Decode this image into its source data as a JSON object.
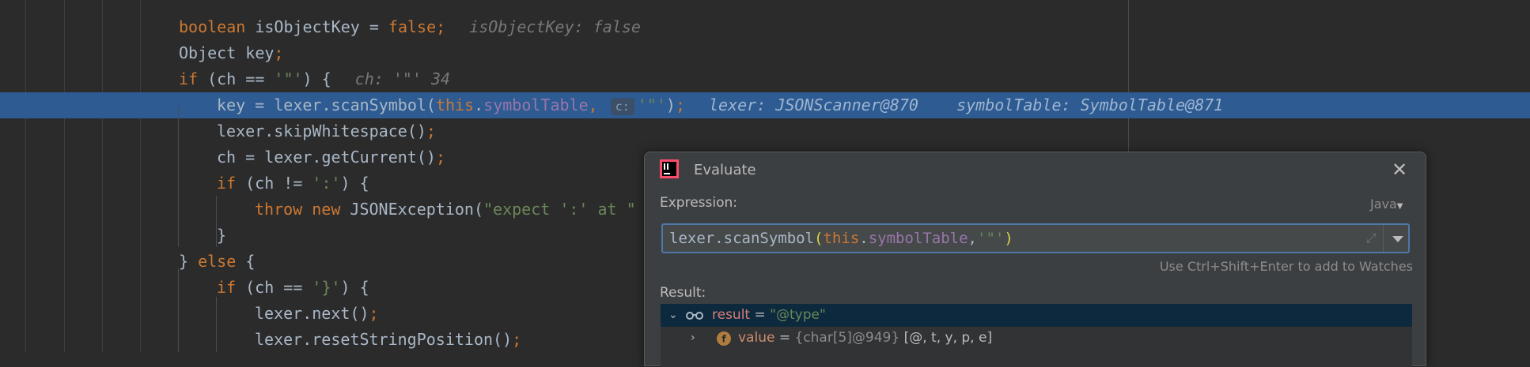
{
  "code_lines": [
    {
      "t": [
        [
          "kw",
          "boolean "
        ],
        [
          "",
          "isObjectKey = "
        ],
        [
          "kw",
          "false"
        ],
        [
          "kw",
          ";"
        ]
      ],
      "hint": "isObjectKey: false"
    },
    {
      "t": [
        [
          "",
          "Object key"
        ],
        [
          "kw",
          ";"
        ]
      ]
    },
    {
      "t": [
        [
          "kw",
          "if "
        ],
        [
          "",
          "(ch == "
        ],
        [
          "str",
          "'\"'"
        ],
        [
          "",
          ") {"
        ]
      ],
      "hint": "ch: '\"' 34"
    },
    {
      "t": [
        [
          "",
          "key = lexer.scanSymbol("
        ],
        [
          "kw",
          "this"
        ],
        [
          "",
          "."
        ],
        [
          "fld",
          "symbolTable"
        ],
        [
          "kw",
          ", "
        ]
      ],
      "param": "c:",
      "t2": [
        [
          "str",
          "'\"'"
        ],
        [
          "",
          ")"
        ],
        [
          "kw",
          ";"
        ]
      ],
      "hint": "lexer: JSONScanner@870    symbolTable: SymbolTable@871"
    },
    {
      "t": [
        [
          "",
          "lexer.skipWhitespace()"
        ],
        [
          "kw",
          ";"
        ]
      ]
    },
    {
      "t": [
        [
          "",
          "ch = lexer.getCurrent()"
        ],
        [
          "kw",
          ";"
        ]
      ]
    },
    {
      "t": [
        [
          "kw",
          "if "
        ],
        [
          "",
          "(ch != "
        ],
        [
          "str",
          "':'"
        ],
        [
          "",
          ") {"
        ]
      ]
    },
    {
      "t": [
        [
          "kw",
          "throw new "
        ],
        [
          "",
          "JSONException("
        ],
        [
          "str",
          "\"expect ':' at \" "
        ]
      ]
    },
    {
      "t": [
        [
          "",
          "}"
        ]
      ]
    },
    {
      "t": [
        [
          "",
          "} "
        ],
        [
          "kw",
          "else "
        ],
        [
          "",
          "{"
        ]
      ]
    },
    {
      "t": [
        [
          "kw",
          "if "
        ],
        [
          "",
          "(ch == "
        ],
        [
          "str",
          "'}'"
        ],
        [
          "",
          ") {"
        ]
      ]
    },
    {
      "t": [
        [
          "",
          "lexer.next()"
        ],
        [
          "kw",
          ";"
        ]
      ]
    },
    {
      "t": [
        [
          "",
          "lexer.resetStringPosition()"
        ],
        [
          "kw",
          ";"
        ]
      ]
    }
  ],
  "dialog": {
    "title": "Evaluate",
    "expression_label": "Expression:",
    "language": "Java",
    "expression_parts": [
      [
        "",
        "lexer.scanSymbol"
      ],
      [
        "paren",
        "("
      ],
      [
        "kw",
        "this"
      ],
      [
        "",
        "."
      ],
      [
        "fld",
        "symbolTable"
      ],
      [
        "",
        ","
      ],
      [
        "str",
        "'\"'"
      ],
      [
        "paren",
        ")"
      ]
    ],
    "watch_hint": "Use Ctrl+Shift+Enter to add to Watches",
    "result_label": "Result:",
    "result_rows": [
      {
        "name": "result",
        "eq": " = ",
        "value": "\"@type\"",
        "meta": "",
        "extra": ""
      },
      {
        "name": "value",
        "eq": " = ",
        "value": "",
        "meta": "{char[5]@949}",
        "extra": " [@, t, y, p, e]"
      }
    ]
  },
  "colors": {
    "highlight": "#2d5b92",
    "keyword": "#cc7832",
    "string": "#6a8759",
    "field": "#9876aa"
  }
}
